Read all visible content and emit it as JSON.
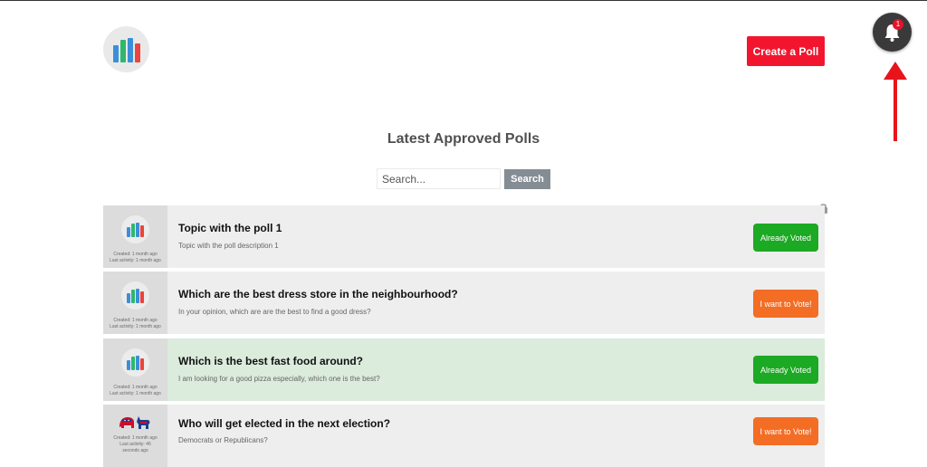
{
  "header": {
    "create_poll_label": "Create a Poll",
    "notification_count": "1"
  },
  "page_title": "Latest Approved Polls",
  "search": {
    "placeholder": "Search...",
    "button_label": "Search"
  },
  "polls": [
    {
      "title": "Topic with the poll 1",
      "description": "Topic with the poll description 1",
      "created": "Created: 1 month ago",
      "last_activity": "Last activity: 1 month ago",
      "button_label": "Already Voted",
      "status": "voted",
      "thumbnail": "poll-chart-icon",
      "locked": true
    },
    {
      "title": "Which are the best dress store in the neighbourhood?",
      "description": "In your opinion, which are are the best to find a good dress?",
      "created": "Created: 1 month ago",
      "last_activity": "Last activity: 1 month ago",
      "button_label": "I want to Vote!",
      "status": "open",
      "thumbnail": "poll-chart-icon"
    },
    {
      "title": "Which is the best fast food around?",
      "description": "I am looking for a good pizza especially, which one is the best?",
      "created": "Created: 1 month ago",
      "last_activity": "Last activity: 1 month ago",
      "button_label": "Already Voted",
      "status": "voted",
      "highlighted": true,
      "thumbnail": "poll-chart-icon"
    },
    {
      "title": "Who will get elected in the next election?",
      "description": "Democrats or Republicans?",
      "created": "Created: 1 month ago",
      "last_activity": "Last activity: 46 seconds ago",
      "button_label": "I want to Vote!",
      "status": "open",
      "thumbnail": "elephant-donkey-icon"
    }
  ],
  "colors": {
    "create_button": "#f1162e",
    "voted_button": "#1ca923",
    "vote_button": "#f46d24",
    "highlight_row": "#dbebdc",
    "annotation_arrow": "#e8141c"
  }
}
